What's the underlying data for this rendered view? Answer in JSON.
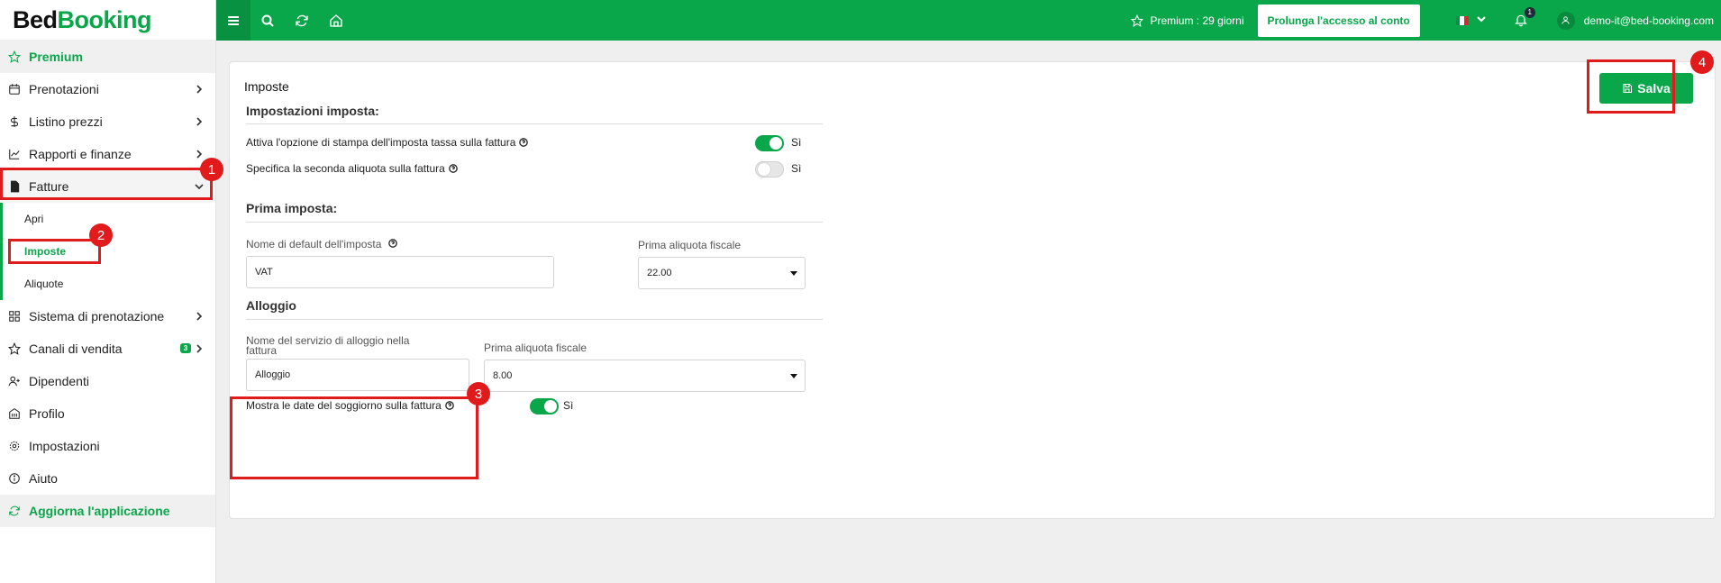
{
  "logo": {
    "part1": "Bed",
    "part2": "Booking"
  },
  "sidebar": {
    "items": [
      {
        "label": "Premium"
      },
      {
        "label": "Prenotazioni"
      },
      {
        "label": "Listino prezzi"
      },
      {
        "label": "Rapporti e finanze"
      },
      {
        "label": "Fatture"
      },
      {
        "label": "Sistema di prenotazione"
      },
      {
        "label": "Canali di vendita",
        "badge": "3"
      },
      {
        "label": "Dipendenti"
      },
      {
        "label": "Profilo"
      },
      {
        "label": "Impostazioni"
      },
      {
        "label": "Aiuto"
      },
      {
        "label": "Aggiorna l'applicazione"
      }
    ],
    "invoice_sub": [
      {
        "label": "Apri"
      },
      {
        "label": "Imposte"
      },
      {
        "label": "Aliquote"
      }
    ]
  },
  "topbar": {
    "premium_status": "Premium : 29 giorni",
    "extend_label": "Prolunga l'accesso al conto",
    "notifications": "1",
    "user_email": "demo-it@bed-booking.com"
  },
  "card": {
    "title": "Imposte",
    "save_label": "Salva",
    "settings_title": "Impostazioni imposta:",
    "opt_print_tax": "Attiva l'opzione di stampa dell'imposta tassa sulla fattura",
    "opt_second_rate": "Specifica la seconda aliquota sulla fattura",
    "yes": "Sì",
    "first_tax_title": "Prima imposta:",
    "default_tax_name_label": "Nome di default dell'imposta",
    "default_tax_name_value": "VAT",
    "first_rate_label": "Prima aliquota fiscale",
    "first_rate_value": "22.00",
    "accommodation_title": "Alloggio",
    "service_name_label": "Nome del servizio di alloggio nella fattura",
    "service_name_value": "Alloggio",
    "accom_rate_label": "Prima aliquota fiscale",
    "accom_rate_value": "8.00",
    "show_dates_label": "Mostra le date del soggiorno sulla fattura"
  },
  "markers": [
    "1",
    "2",
    "3",
    "4"
  ],
  "colors": {
    "brand": "#0aa64a",
    "annotation": "#e11b1b"
  }
}
